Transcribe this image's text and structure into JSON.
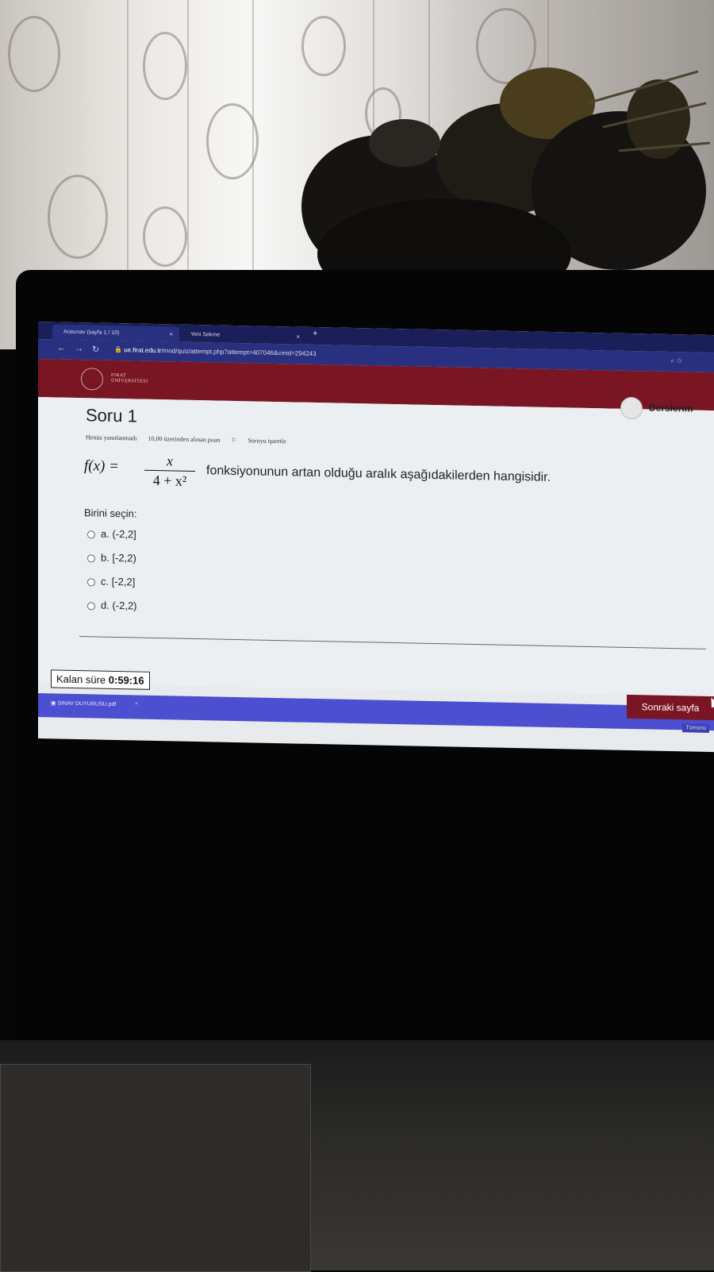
{
  "browser": {
    "tabs": [
      {
        "label": "Arasınav (sayfa 1 / 10)",
        "close": "×"
      },
      {
        "label": "Yeni Sekme",
        "close": "×"
      }
    ],
    "new_tab": "+",
    "url_host": "ue.firat.edu.tr",
    "url_path": "/mod/quiz/attempt.php?attempt=407046&cmid=294243"
  },
  "header": {
    "logo_line1": "FIRAT",
    "logo_line2": "ÜNİVERSİTESİ",
    "user_menu": "Derslerim",
    "brand_color": "#7a1523"
  },
  "question": {
    "title": "Soru 1",
    "status": "Henüz yanıtlanmadı",
    "points": "10,00 üzerinden alınan puan",
    "flag": "Soruyu işaretle",
    "formula_lhs": "f(x) =",
    "formula_num": "x",
    "formula_den": "4 + x²",
    "text": "fonksiyonunun artan olduğu aralık  aşağıdakilerden hangisidir.",
    "prompt": "Birini seçin:",
    "options": [
      {
        "label": "a. (-2,2]"
      },
      {
        "label": "b. [-2,2)"
      },
      {
        "label": "c. [-2,2]"
      },
      {
        "label": "d. (-2,2)"
      }
    ]
  },
  "footer": {
    "timer_label": "Kalan süre",
    "timer_value": "0:59:16",
    "next_button": "Sonraki sayfa",
    "download_file": "SINAV DUYURUSU.pdf",
    "download_all": "Tümünü"
  }
}
